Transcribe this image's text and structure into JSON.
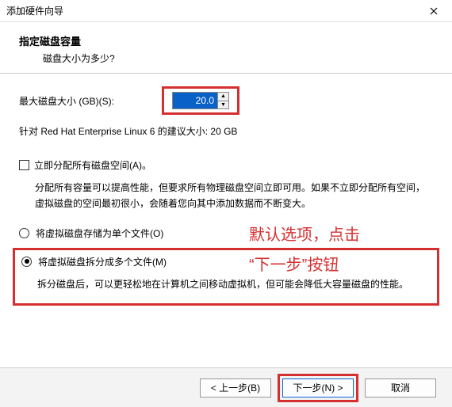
{
  "titlebar": {
    "title": "添加硬件向导"
  },
  "header": {
    "title": "指定磁盘容量",
    "subtitle": "磁盘大小为多少?"
  },
  "size": {
    "label": "最大磁盘大小 (GB)(S):",
    "value": "20.0"
  },
  "recommendation": "针对 Red Hat Enterprise Linux 6 的建议大小: 20 GB",
  "allocate": {
    "label": "立即分配所有磁盘空间(A)。",
    "desc": "分配所有容量可以提高性能，但要求所有物理磁盘空间立即可用。如果不立即分配所有空间，虚拟磁盘的空间最初很小，会随着您向其中添加数据而不断变大。"
  },
  "radio_single": {
    "label": "将虚拟磁盘存储为单个文件(O)"
  },
  "radio_split": {
    "label": "将虚拟磁盘拆分成多个文件(M)",
    "desc": "拆分磁盘后，可以更轻松地在计算机之间移动虚拟机，但可能会降低大容量磁盘的性能。"
  },
  "annotation": {
    "line1": "默认选项，点击",
    "line2": "“下一步”按钮"
  },
  "footer": {
    "back": "< 上一步(B)",
    "next": "下一步(N) >",
    "cancel": "取消"
  }
}
